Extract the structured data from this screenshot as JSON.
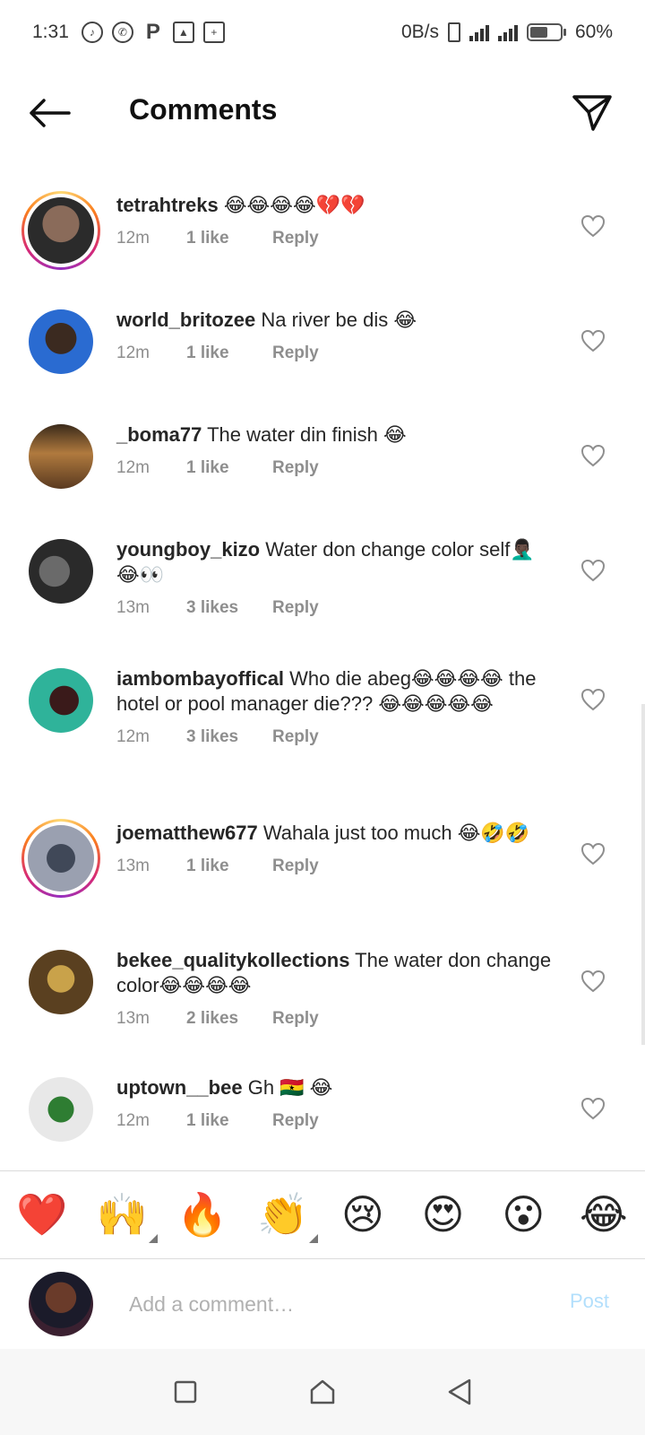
{
  "status_bar": {
    "time": "1:31",
    "net_speed": "0B/s",
    "battery": "60%",
    "battery_level": 0.6
  },
  "header": {
    "title": "Comments",
    "back_icon": "arrow-left-icon",
    "send_icon": "paper-plane-icon"
  },
  "comments": [
    {
      "username": "tetrahtreks",
      "text": "😂😂😂😂💔💔",
      "time": "12m",
      "likes": "1 like",
      "reply": "Reply",
      "story_ring": true,
      "avatar_colors": [
        "#8a6b5a",
        "#2b2b2b"
      ]
    },
    {
      "username": "world_britozee",
      "text": "Na river be dis 😂",
      "time": "12m",
      "likes": "1 like",
      "reply": "Reply",
      "story_ring": false,
      "avatar_colors": [
        "#2a6bd1",
        "#3b2a20"
      ]
    },
    {
      "username": "_boma77",
      "text": "The water din finish 😂",
      "time": "12m",
      "likes": "1 like",
      "reply": "Reply",
      "story_ring": false,
      "avatar_colors": [
        "#b07a3e",
        "#5a3a20"
      ]
    },
    {
      "username": "youngboy_kizo",
      "text": "Water don change color self🤦🏿‍♂️😂👀",
      "time": "13m",
      "likes": "3 likes",
      "reply": "Reply",
      "story_ring": false,
      "avatar_colors": [
        "#6a6a6a",
        "#2a2a2a"
      ]
    },
    {
      "username": "iambombayoffical",
      "text": "Who die abeg😂😂😂😂 the hotel or pool manager die??? 😂😂😂😂😂",
      "time": "12m",
      "likes": "3 likes",
      "reply": "Reply",
      "story_ring": false,
      "avatar_colors": [
        "#2fb39a",
        "#3a1a1a"
      ]
    },
    {
      "username": "joematthew677",
      "text": "Wahala just too much 😂🤣🤣",
      "time": "13m",
      "likes": "1 like",
      "reply": "Reply",
      "story_ring": true,
      "avatar_colors": [
        "#9aa0b0",
        "#404858"
      ]
    },
    {
      "username": "bekee_qualitykollections",
      "text": "The water don change color😂😂😂😂",
      "time": "13m",
      "likes": "2 likes",
      "reply": "Reply",
      "story_ring": false,
      "avatar_colors": [
        "#c9a24a",
        "#5a4020"
      ]
    },
    {
      "username": "uptown__bee",
      "text": "Gh 🇬🇭 😂",
      "time": "12m",
      "likes": "1 like",
      "reply": "Reply",
      "story_ring": false,
      "avatar_colors": [
        "#e8e8e8",
        "#2e7d32"
      ]
    }
  ],
  "emoji_bar": [
    "❤️",
    "🙌",
    "🔥",
    "👏",
    "😢",
    "😍",
    "😮",
    "😂"
  ],
  "input": {
    "placeholder": "Add a comment…",
    "post_label": "Post"
  }
}
